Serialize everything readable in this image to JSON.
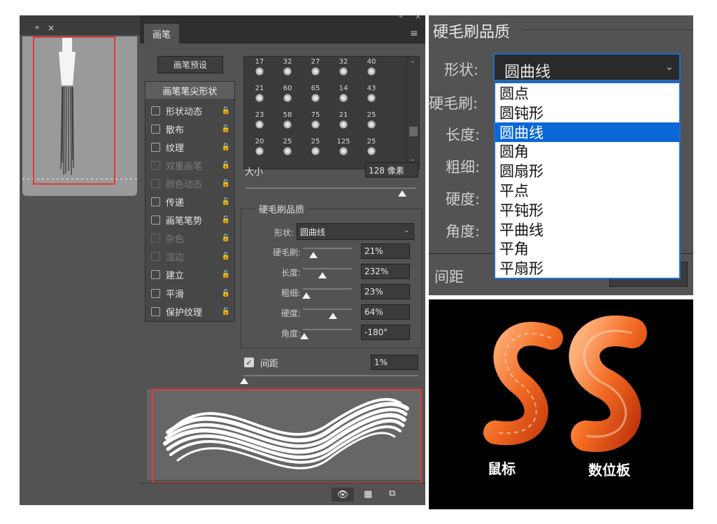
{
  "brush_panel": {
    "tab_label": "画笔",
    "presets_button": "画笔预设",
    "tip_shape_header": "画笔笔尖形状",
    "options": [
      {
        "label": "形状动态",
        "enabled": true
      },
      {
        "label": "散布",
        "enabled": true
      },
      {
        "label": "纹理",
        "enabled": true
      },
      {
        "label": "双重画笔",
        "enabled": false
      },
      {
        "label": "颜色动态",
        "enabled": false
      },
      {
        "label": "传递",
        "enabled": true
      },
      {
        "label": "画笔笔势",
        "enabled": true
      },
      {
        "label": "杂色",
        "enabled": false
      },
      {
        "label": "湿边",
        "enabled": false
      },
      {
        "label": "建立",
        "enabled": true
      },
      {
        "label": "平滑",
        "enabled": true
      },
      {
        "label": "保护纹理",
        "enabled": true
      }
    ],
    "brush_sizes": [
      "17",
      "32",
      "27",
      "32",
      "40",
      "21",
      "60",
      "65",
      "14",
      "43",
      "23",
      "58",
      "75",
      "21",
      "25",
      "20",
      "25",
      "25",
      "125",
      "25"
    ],
    "size_label": "大小",
    "size_value": "128 像素",
    "bristle_section_title": "硬毛刷品质",
    "shape_label": "形状:",
    "shape_value": "圆曲线",
    "params": [
      {
        "label": "硬毛刷:",
        "value": "21%",
        "level": 0.21
      },
      {
        "label": "长度:",
        "value": "232%",
        "level": 0.4
      },
      {
        "label": "粗细:",
        "value": "23%",
        "level": 0.05
      },
      {
        "label": "硬度:",
        "value": "64%",
        "level": 0.64
      },
      {
        "label": "角度:",
        "value": "-180°",
        "level": 0.0
      }
    ],
    "spacing_label": "间距",
    "spacing_value": "1%"
  },
  "zoom_panel": {
    "title": "硬毛刷品质",
    "shape_label": "形状:",
    "shape_value": "圆曲线",
    "row_labels": [
      "硬毛刷:",
      "长度:",
      "粗细:",
      "硬度:",
      "角度:"
    ],
    "spacing_label": "间距",
    "dropdown_options": [
      "圆点",
      "圆钝形",
      "圆曲线",
      "圆角",
      "圆扇形",
      "平点",
      "平钝形",
      "平曲线",
      "平角",
      "平扇形"
    ],
    "selected_index": 2
  },
  "render_panel": {
    "left_caption": "鼠标",
    "right_caption": "数位板"
  },
  "colors": {
    "panel_bg": "#535353",
    "selection_blue": "#0a67d6",
    "highlight_red": "#e23a3a",
    "paint_orange": "#f26a22"
  }
}
